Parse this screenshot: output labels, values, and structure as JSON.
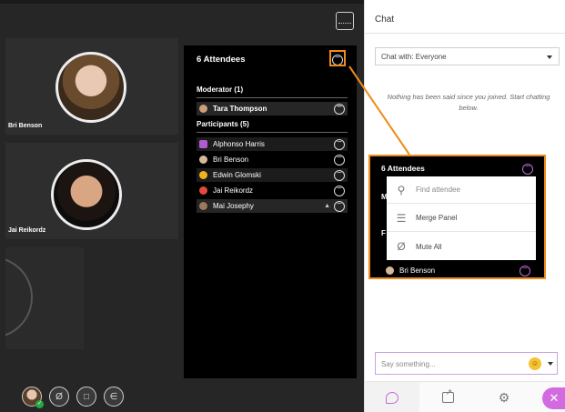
{
  "stage": {
    "tiles": [
      {
        "name": "Bri Benson"
      },
      {
        "name": "Jai Reikordz"
      }
    ]
  },
  "attendees_panel": {
    "title": "6 Attendees",
    "moderator_header": "Moderator (1)",
    "moderator": {
      "name": "Tara Thompson"
    },
    "participants_header": "Participants (5)",
    "participants": [
      {
        "name": "Alphonso Harris"
      },
      {
        "name": "Bri Benson"
      },
      {
        "name": "Edwin Glomski"
      },
      {
        "name": "Jai Reikordz"
      },
      {
        "name": "Mai Josephy"
      }
    ]
  },
  "callout": {
    "title": "6 Attendees",
    "partial_letters": [
      "M",
      "F"
    ],
    "menu": {
      "find_placeholder": "Find attendee",
      "merge_label": "Merge Panel",
      "mute_label": "Mute All"
    },
    "row_name": "Bri Benson",
    "highlight_color": "#f08a1a"
  },
  "chat": {
    "title": "Chat",
    "select_value": "Chat with: Everyone",
    "empty_message": "Nothing has been said since you joined. Start chatting below.",
    "input_placeholder": "Say something...",
    "accent_color": "#c16cd8"
  },
  "icons": {
    "layout": "layout-icon",
    "more": "more-options-icon",
    "search": "search-icon",
    "merge": "merge-panel-icon",
    "mute": "microphone-muted-icon",
    "emoji": "emoji-icon",
    "chat_tab": "chat-bubble-icon",
    "share_tab": "share-content-icon",
    "settings_tab": "gear-icon",
    "close": "close-icon"
  }
}
